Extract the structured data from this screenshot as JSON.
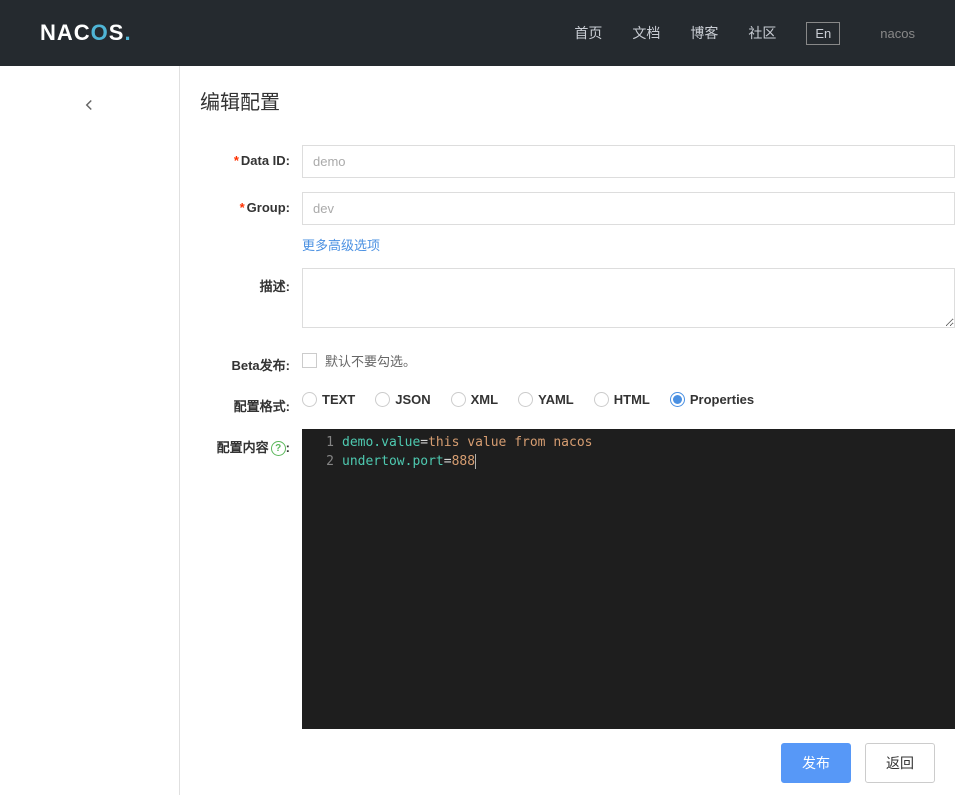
{
  "header": {
    "logo_part1": "NAC",
    "logo_part2": "O",
    "logo_part3": "S",
    "logo_dot": ".",
    "nav": [
      "首页",
      "文档",
      "博客",
      "社区"
    ],
    "lang": "En",
    "user": "nacos"
  },
  "page": {
    "title": "编辑配置"
  },
  "form": {
    "data_id_label": "Data ID:",
    "data_id_value": "demo",
    "group_label": "Group:",
    "group_value": "dev",
    "more_options": "更多高级选项",
    "description_label": "描述:",
    "description_value": "",
    "beta_label": "Beta发布:",
    "beta_hint": "默认不要勾选。",
    "format_label": "配置格式:",
    "formats": [
      "TEXT",
      "JSON",
      "XML",
      "YAML",
      "HTML",
      "Properties"
    ],
    "format_selected": "Properties",
    "content_label": "配置内容",
    "content_colon": ":",
    "code_lines": [
      {
        "n": "1",
        "key": "demo.value",
        "op": "=",
        "val": "this value from nacos"
      },
      {
        "n": "2",
        "key": "undertow.port",
        "op": "=",
        "val": "888"
      }
    ]
  },
  "buttons": {
    "publish": "发布",
    "back": "返回"
  }
}
